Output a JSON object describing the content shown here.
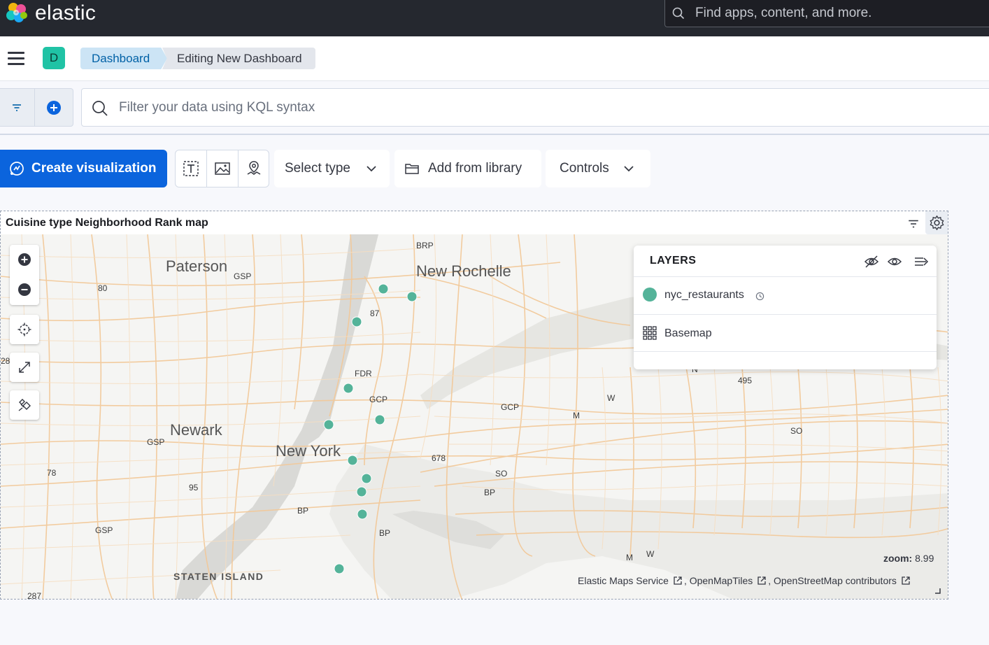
{
  "header": {
    "brand": "elastic",
    "search_placeholder": "Find apps, content, and more."
  },
  "breadcrumbs": {
    "space_initial": "D",
    "items": [
      "Dashboard",
      "Editing New Dashboard"
    ]
  },
  "query": {
    "placeholder": "Filter your data using KQL syntax"
  },
  "toolbar": {
    "create_label": "Create visualization",
    "select_type_label": "Select type",
    "add_from_library_label": "Add from library",
    "controls_label": "Controls"
  },
  "panel": {
    "title": "Cuisine type Neighborhood Rank map"
  },
  "map": {
    "cities": [
      "Paterson",
      "New Rochelle",
      "Newark",
      "New York",
      "STATEN ISLAND"
    ],
    "road_labels": [
      "BRP",
      "GSP",
      "80",
      "87",
      "FDR",
      "GCP",
      "GCP",
      "GSP",
      "678",
      "M",
      "W",
      "SO",
      "BP",
      "78",
      "95",
      "BP",
      "BP",
      "GSP",
      "495",
      "SO",
      "M",
      "W",
      "287",
      "28",
      "N"
    ],
    "point_color": "#54b399",
    "zoom_label": "zoom:",
    "zoom_value": "8.99",
    "attribution": [
      "Elastic Maps Service",
      "OpenMapTiles",
      "OpenStreetMap contributors"
    ]
  },
  "layers": {
    "title": "LAYERS",
    "items": [
      {
        "name": "nyc_restaurants",
        "icon": "circle-point-icon"
      },
      {
        "name": "Basemap",
        "icon": "grid-icon"
      }
    ]
  },
  "colors": {
    "header_bg": "#25282f",
    "primary": "#0b64dd",
    "accent_teal": "#20c3a5",
    "breadcrumb_active_bg": "#cce4f5"
  }
}
